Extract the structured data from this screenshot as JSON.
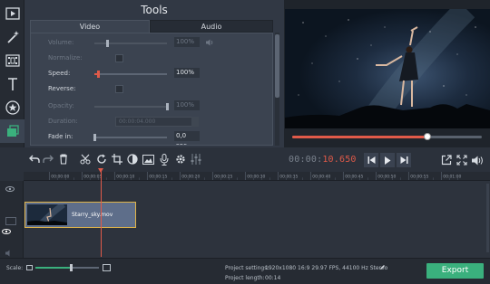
{
  "tools_panel": {
    "title": "Tools",
    "tabs": [
      {
        "label": "Video",
        "active": true
      },
      {
        "label": "Audio",
        "active": false
      }
    ],
    "properties": {
      "volume": {
        "label": "Volume:",
        "value": "100%",
        "level": 0.18,
        "enabled": false
      },
      "normalize": {
        "label": "Normalize:",
        "checked": false,
        "enabled": false
      },
      "speed": {
        "label": "Speed:",
        "value": "100%",
        "level": 0.05,
        "enabled": true
      },
      "reverse": {
        "label": "Reverse:",
        "checked": false,
        "enabled": true
      },
      "opacity": {
        "label": "Opacity:",
        "value": "100%",
        "level": 1.0,
        "enabled": false
      },
      "duration": {
        "label": "Duration:",
        "value": "00:00:04.000",
        "enabled": false
      },
      "fade_in": {
        "label": "Fade in:",
        "value": "0,0 sec.",
        "level": 0.0,
        "enabled": true
      }
    }
  },
  "preview": {
    "seek_progress": 0.72
  },
  "toolbar": {
    "timecode_dim": "00:00:",
    "timecode_hi": "10.650"
  },
  "timeline": {
    "ruler_ticks": [
      "00:00:00",
      "00:00:05",
      "00:00:10",
      "00:00:15",
      "00:00:20",
      "00:00:25",
      "00:00:30",
      "00:00:35",
      "00:00:40",
      "00:00:45",
      "00:00:50",
      "00:00:55",
      "00:01:00"
    ],
    "clip": {
      "name": "Starry_sky.mov"
    }
  },
  "footer": {
    "scale_label": "Scale:",
    "scale_level": 0.55,
    "project_settings_label": "Project settings:",
    "project_settings_value": "1920x1080 16:9 29.97 FPS, 44100 Hz Stereo",
    "project_length_label": "Project length:",
    "project_length_value": "00:14",
    "export_label": "Export"
  },
  "colors": {
    "accent": "#e05a49",
    "export_green": "#3ab07d",
    "clip_border": "#e0b44a",
    "panel_bg": "#313844"
  },
  "icons": {
    "toolstrip": [
      "import-icon",
      "magic-wand-icon",
      "filters-icon",
      "titles-icon",
      "stickers-icon",
      "transitions-icon",
      "more-tools-icon"
    ],
    "toolbar": [
      "undo-icon",
      "redo-icon",
      "delete-icon",
      "cut-icon",
      "rotate-icon",
      "crop-icon",
      "color-adjust-icon",
      "insert-media-icon",
      "record-audio-icon",
      "settings-icon",
      "equalizer-icon",
      "prev-frame-icon",
      "play-icon",
      "next-frame-icon",
      "detach-preview-icon",
      "fullscreen-icon",
      "volume-icon"
    ]
  }
}
